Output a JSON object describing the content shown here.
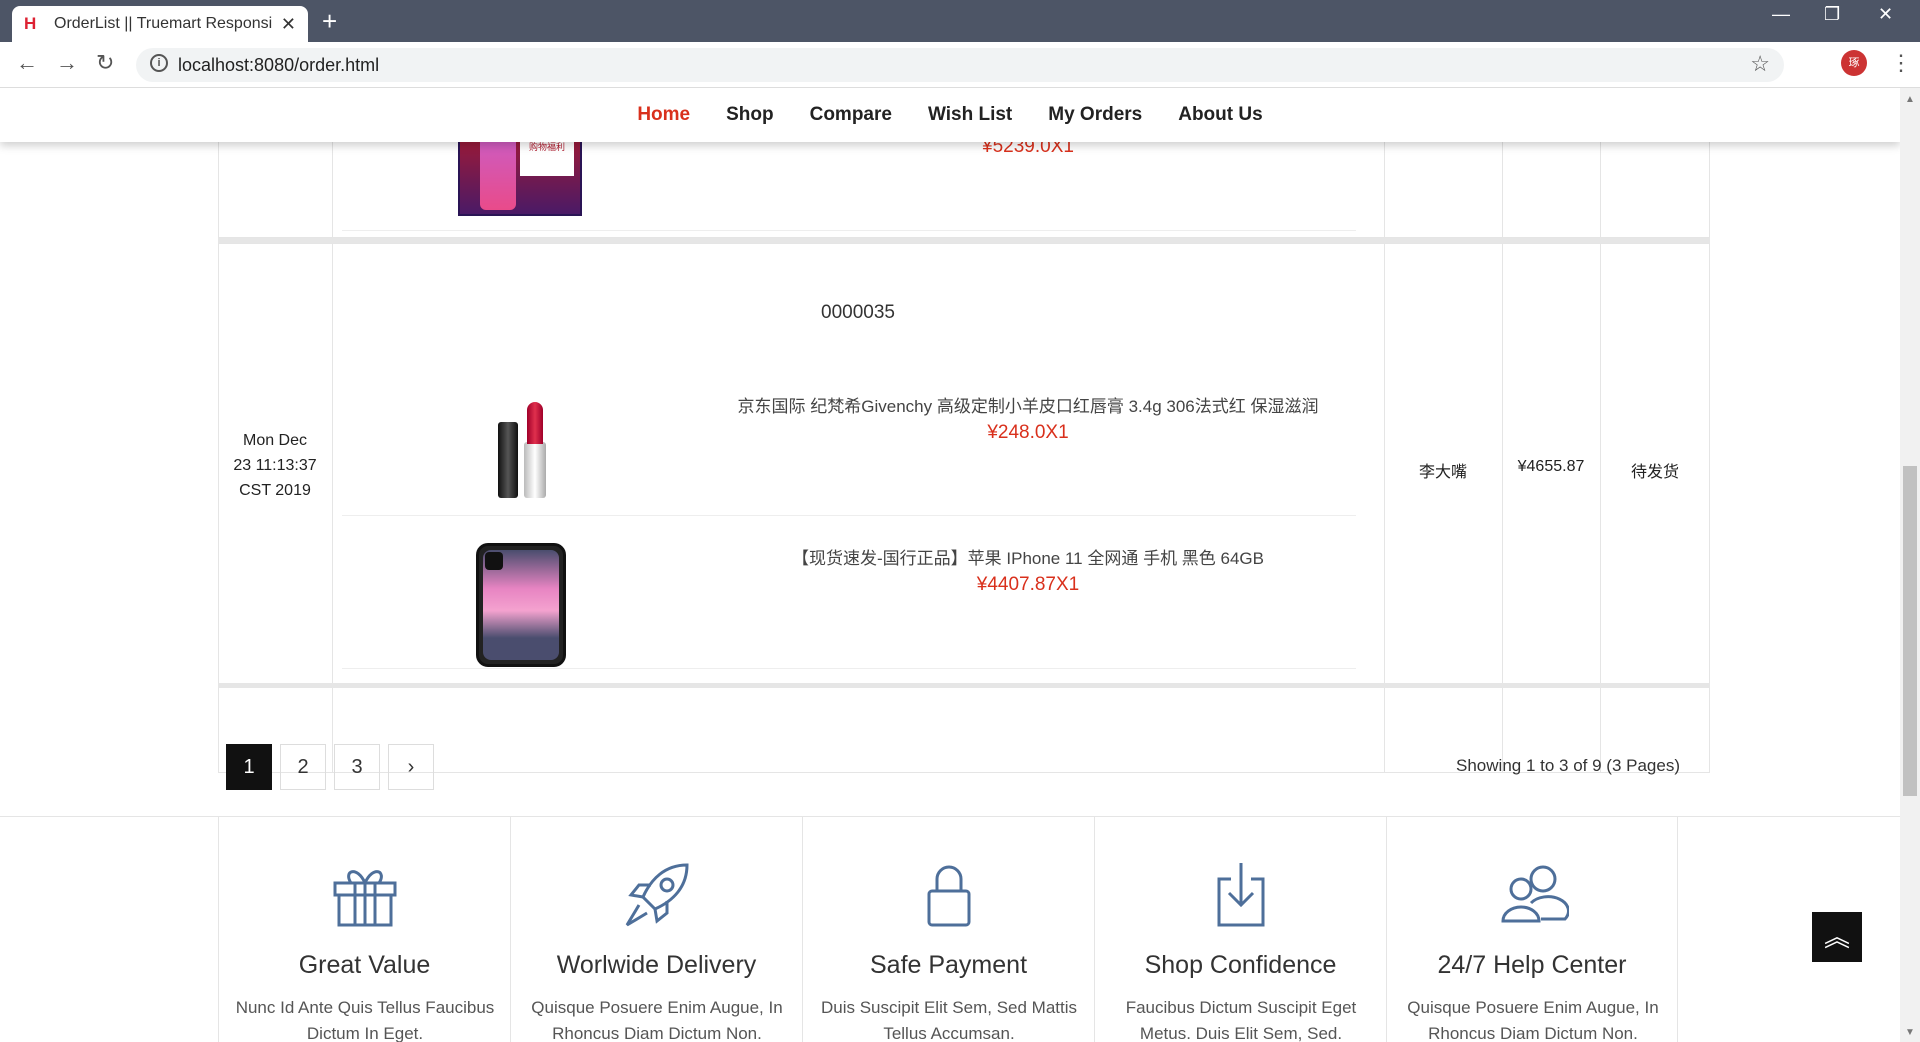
{
  "browser": {
    "tab_title": "OrderList || Truemart Responsi",
    "url": "localhost:8080/order.html",
    "profile_initial": "琢"
  },
  "nav": {
    "items": [
      "Home",
      "Shop",
      "Compare",
      "Wish List",
      "My Orders",
      "About Us"
    ],
    "active": "Home"
  },
  "orders": [
    {
      "items": [
        {
          "price": "¥5239.0X1",
          "image": "red-phone-promo"
        }
      ]
    },
    {
      "order_no": "0000035",
      "date": [
        "Mon Dec",
        "23 11:13:37",
        "CST 2019"
      ],
      "customer": "李大嘴",
      "total": "¥4655.87",
      "status": "待发货",
      "items": [
        {
          "name": "京东国际 纪梵希Givenchy 高级定制小羊皮口红唇膏 3.4g 306法式红 保湿滋润",
          "price": "¥248.0X1",
          "image": "lipstick"
        },
        {
          "name": "【现货速发-国行正品】苹果 IPhone 11 全网通 手机 黑色 64GB",
          "price": "¥4407.87X1",
          "image": "iphone-11-black"
        }
      ]
    }
  ],
  "pagination": {
    "pages": [
      "1",
      "2",
      "3"
    ],
    "next": "›",
    "active": "1",
    "showing": "Showing 1 to 3 of 9 (3 Pages)"
  },
  "features": [
    {
      "icon": "gift-icon",
      "title": "Great Value",
      "text": "Nunc Id Ante Quis Tellus Faucibus Dictum In Eget."
    },
    {
      "icon": "rocket-icon",
      "title": "Worlwide Delivery",
      "text": "Quisque Posuere Enim Augue, In Rhoncus Diam Dictum Non."
    },
    {
      "icon": "lock-icon",
      "title": "Safe Payment",
      "text": "Duis Suscipit Elit Sem, Sed Mattis Tellus Accumsan."
    },
    {
      "icon": "download-icon",
      "title": "Shop Confidence",
      "text": "Faucibus Dictum Suscipit Eget Metus. Duis Elit Sem, Sed."
    },
    {
      "icon": "users-icon",
      "title": "24/7 Help Center",
      "text": "Quisque Posuere Enim Augue, In Rhoncus Diam Dictum Non."
    }
  ]
}
